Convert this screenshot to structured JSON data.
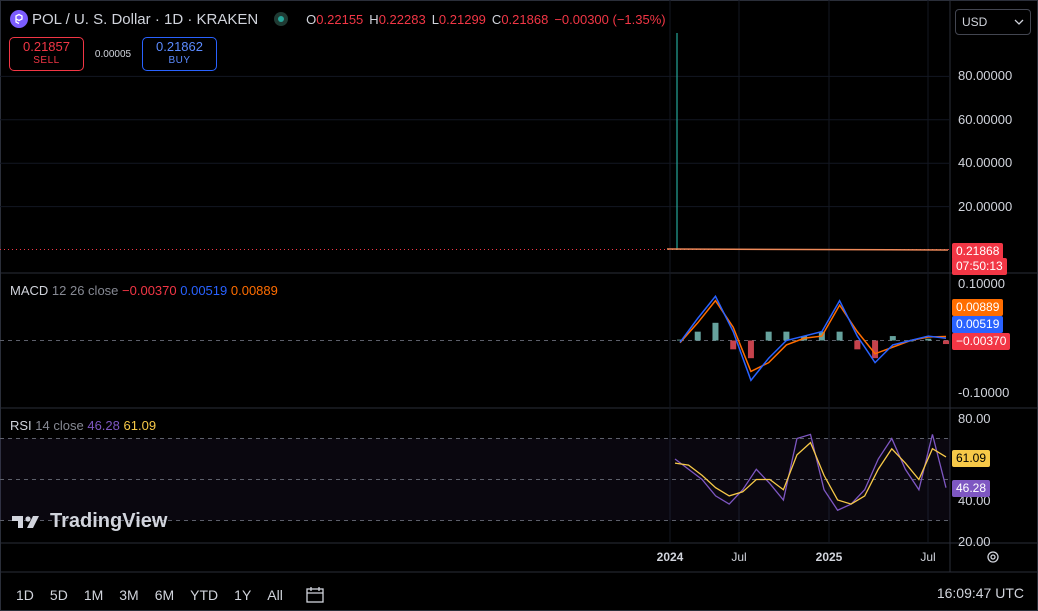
{
  "header": {
    "title": "POL / U. S. Dollar · 1D · KRAKEN",
    "ohlc": [
      {
        "k": "O",
        "v": "0.22155"
      },
      {
        "k": "H",
        "v": "0.22283"
      },
      {
        "k": "L",
        "v": "0.21299"
      },
      {
        "k": "C",
        "v": "0.21868"
      },
      {
        "k": "",
        "v": "−0.00300 (−1.35%)"
      }
    ]
  },
  "currency": {
    "label": "USD"
  },
  "trade": {
    "sell_price": "0.21857",
    "sell_label": "SELL",
    "spread": "0.00005",
    "buy_price": "0.21862",
    "buy_label": "BUY"
  },
  "price_tag": {
    "price": "0.21868",
    "countdown": "07:50:13"
  },
  "macd": {
    "name": "MACD",
    "params": "12 26 close",
    "v1": "−0.00370",
    "v2": "0.00519",
    "v3": "0.00889",
    "tag_signal": "0.00889",
    "tag_macd": "0.00519",
    "tag_hist": "−0.00370"
  },
  "rsi": {
    "name": "RSI",
    "params": "14 close",
    "v1": "46.28",
    "v2": "61.09",
    "tag_ma": "61.09",
    "tag_rsi": "46.28"
  },
  "logo": {
    "text": "TradingView"
  },
  "timeframes": [
    "1D",
    "5D",
    "1M",
    "3M",
    "6M",
    "YTD",
    "1Y",
    "All"
  ],
  "clock": "16:09:47 UTC",
  "colors": {
    "up": "#26a69a",
    "down": "#f23645",
    "macd": "#2962ff",
    "signal": "#ff6d00",
    "rsi": "#7e57c2",
    "rsi_ma": "#f7c948"
  },
  "chart_data": [
    {
      "type": "line",
      "title": "POL / U. S. Dollar · 1D · KRAKEN",
      "x": [
        "2024",
        "Jul",
        "2025",
        "Jul"
      ],
      "series": [],
      "ylim": [
        0,
        100
      ],
      "yticks": [
        "20.00000",
        "40.00000",
        "60.00000",
        "80.00000"
      ],
      "last_price": 0.21868
    },
    {
      "type": "line",
      "title": "MACD 12 26 close",
      "x": [
        "2024",
        "Jul",
        "2025",
        "Jul"
      ],
      "series": [
        {
          "values": [
            -0.004,
            0.05,
            0.1,
            0.02,
            -0.09,
            -0.04,
            0.0,
            0.01,
            0.02,
            0.09,
            0.01,
            -0.05,
            -0.01,
            0.0,
            0.01,
            0.005
          ]
        },
        {
          "values": [
            -0.005,
            0.04,
            0.09,
            0.03,
            -0.07,
            -0.05,
            -0.01,
            0.005,
            0.01,
            0.08,
            0.02,
            -0.03,
            -0.015,
            0.0,
            0.008,
            0.009
          ]
        },
        {
          "values": [
            0.001,
            0.01,
            0.02,
            -0.01,
            -0.02,
            0.01,
            0.01,
            0.005,
            0.01,
            0.01,
            -0.01,
            -0.02,
            0.005,
            0.0,
            0.002,
            -0.004
          ]
        }
      ],
      "yticks": [
        "-0.10000",
        "0.10000"
      ],
      "ylim": [
        -0.13,
        0.13
      ]
    },
    {
      "type": "line",
      "title": "RSI 14 close",
      "x": [
        "2024",
        "Jul",
        "2025",
        "Jul"
      ],
      "series": [
        {
          "values": [
            60,
            55,
            50,
            42,
            38,
            45,
            55,
            48,
            40,
            70,
            72,
            45,
            35,
            38,
            45,
            60,
            70,
            55,
            45,
            72,
            46
          ]
        },
        {
          "values": [
            58,
            57,
            52,
            46,
            42,
            44,
            50,
            50,
            45,
            62,
            68,
            52,
            40,
            38,
            42,
            55,
            65,
            58,
            50,
            65,
            61
          ]
        }
      ],
      "yticks": [
        "20.00",
        "40.00",
        "60.00",
        "80.00"
      ],
      "ylim": [
        20,
        80
      ],
      "bands": [
        30,
        50,
        70
      ]
    }
  ]
}
